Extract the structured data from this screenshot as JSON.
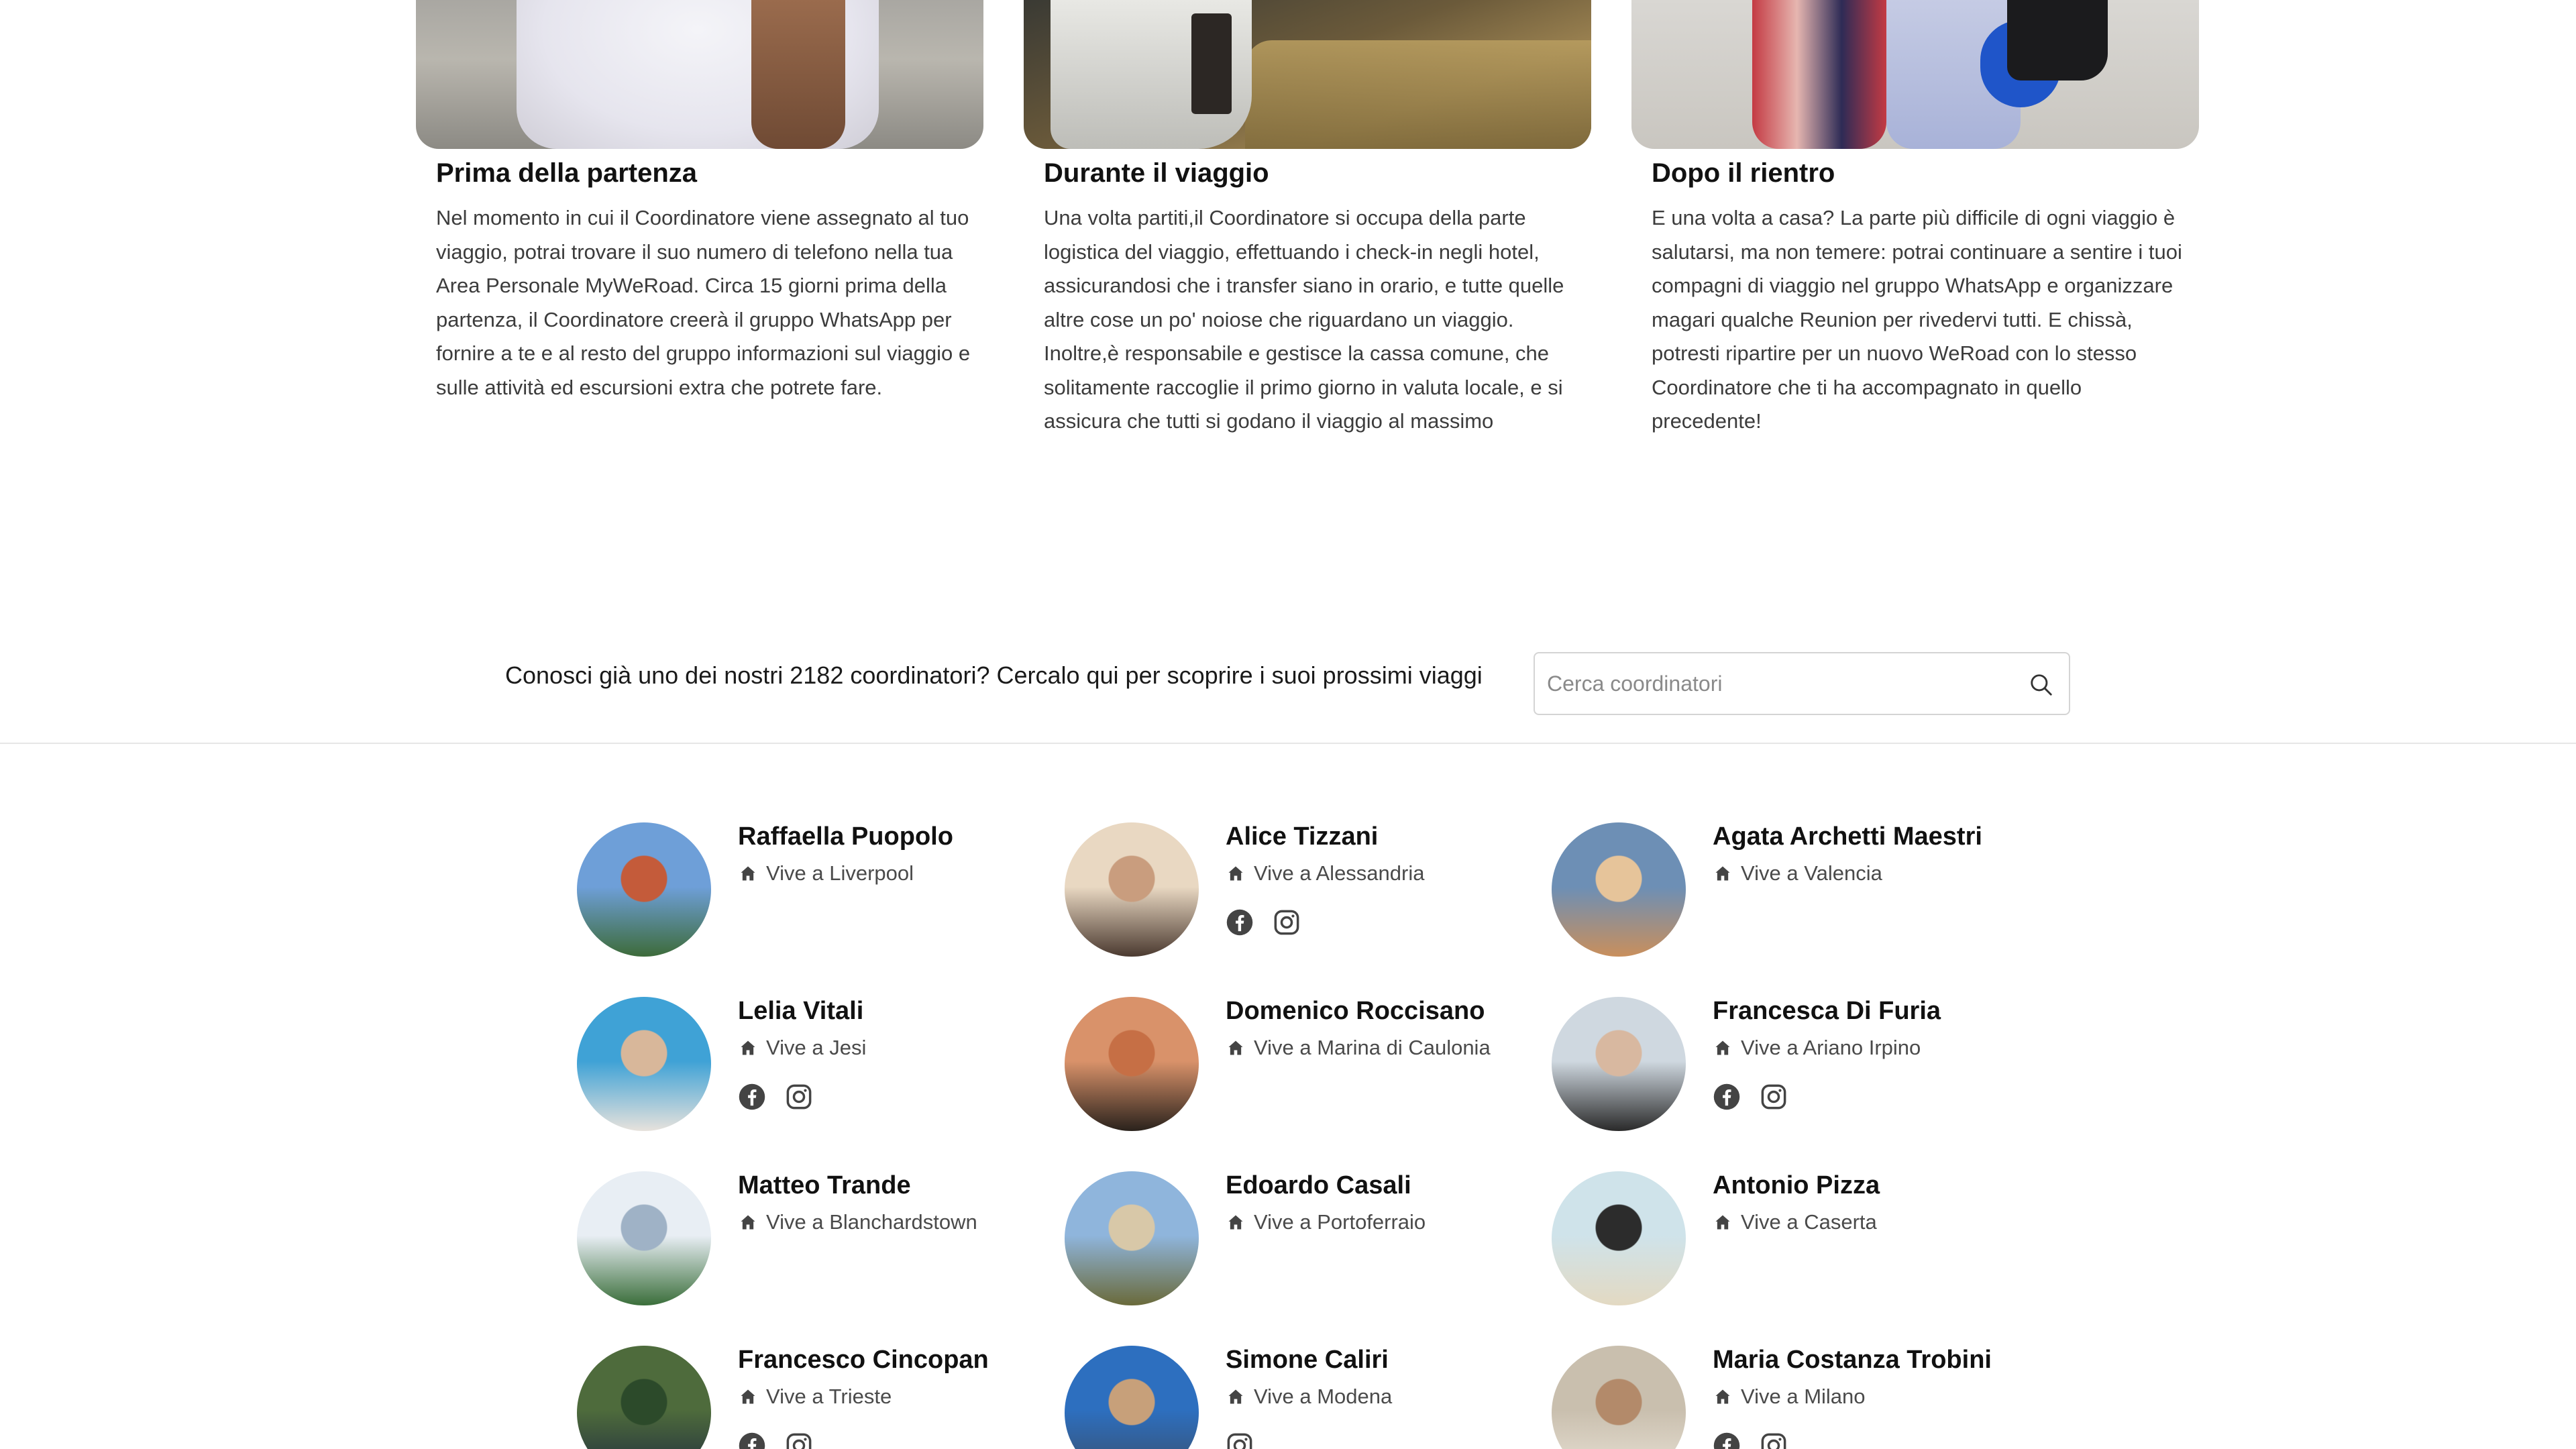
{
  "cards": [
    {
      "photo": "traveler-white-shirt-photo",
      "title": "Prima della partenza",
      "text": "Nel momento in cui il Coordinatore viene assegnato al tuo viaggio, potrai trovare il suo numero di telefono nella tua Area Personale MyWeRoad. Circa 15 giorni prima della partenza, il Coordinatore creerà il gruppo WhatsApp per fornire a te e al resto del gruppo informazioni sul viaggio e sulle attività ed escursioni extra che potrete fare."
    },
    {
      "photo": "travel-bag-puddle-photo",
      "title": "Durante il viaggio",
      "text": "Una volta partiti,il Coordinatore si occupa della parte logistica del viaggio, effettuando i check-in negli hotel, assicurandosi che i transfer siano in orario, e tutte quelle altre cose un po' noiose che riguardano un viaggio. Inoltre,è responsabile e gestisce la cassa comune, che solitamente raccoglie il primo giorno in valuta locale, e si assicura che tutti si godano il viaggio al massimo"
    },
    {
      "photo": "friends-group-photo",
      "title": "Dopo il rientro",
      "text": "E una volta a casa? La parte più difficile di ogni viaggio è salutarsi, ma non temere: potrai continuare a sentire i tuoi compagni di viaggio nel gruppo WhatsApp e organizzare magari qualche Reunion per rivedervi tutti. E chissà, potresti ripartire per un nuovo WeRoad con lo stesso Coordinatore che ti ha accompagnato in quello precedente!"
    }
  ],
  "search": {
    "label": "Conosci già uno dei nostri 2182 coordinatori? Cercalo qui per scoprire i suoi prossimi viaggi",
    "placeholder": "Cerca coordinatori",
    "icon": "search-icon"
  },
  "coordinators": [
    {
      "name": "Raffaella Puopolo",
      "city": "Vive a Liverpool",
      "socials": [],
      "avatar": [
        "#6e9fd8",
        "#c45b3a",
        "#3d6b3a"
      ]
    },
    {
      "name": "Alice Tizzani",
      "city": "Vive a Alessandria",
      "socials": [
        "facebook",
        "instagram"
      ],
      "avatar": [
        "#e9d8c2",
        "#c99d7e",
        "#4b3a30"
      ]
    },
    {
      "name": "Agata Archetti Maestri",
      "city": "Vive a Valencia",
      "socials": [],
      "avatar": [
        "#6d8fb5",
        "#e6c49a",
        "#c98f5c"
      ]
    },
    {
      "name": "Lelia Vitali",
      "city": "Vive a Jesi",
      "socials": [
        "facebook",
        "instagram"
      ],
      "avatar": [
        "#3fa2d6",
        "#d8b79a",
        "#e7e2dc"
      ]
    },
    {
      "name": "Domenico Roccisano",
      "city": "Vive a Marina di Caulonia",
      "socials": [],
      "avatar": [
        "#d9926a",
        "#c66f45",
        "#2a221c"
      ]
    },
    {
      "name": "Francesca Di Furia",
      "city": "Vive a Ariano Irpino",
      "socials": [
        "facebook",
        "instagram"
      ],
      "avatar": [
        "#cfd8e0",
        "#d8b8a0",
        "#2a2a2a"
      ]
    },
    {
      "name": "Matteo Trande",
      "city": "Vive a Blanchardstown",
      "socials": [],
      "avatar": [
        "#e8eef4",
        "#9fb2c6",
        "#3a6e3a"
      ]
    },
    {
      "name": "Edoardo Casali",
      "city": "Vive a Portoferraio",
      "socials": [],
      "avatar": [
        "#8fb5dc",
        "#d8c8a8",
        "#6a6a3a"
      ]
    },
    {
      "name": "Antonio Pizza",
      "city": "Vive a Caserta",
      "socials": [],
      "avatar": [
        "#cfe3ea",
        "#2c2c2c",
        "#e3d9c2"
      ]
    },
    {
      "name": "Francesco Cincopan",
      "city": "Vive a Trieste",
      "socials": [
        "facebook",
        "instagram"
      ],
      "avatar": [
        "#4e6b3c",
        "#2c4a2a",
        "#1f2c3e"
      ]
    },
    {
      "name": "Simone Caliri",
      "city": "Vive a Modena",
      "socials": [
        "instagram"
      ],
      "avatar": [
        "#2d6fbf",
        "#c7a07a",
        "#3a4e6a"
      ]
    },
    {
      "name": "Maria Costanza Trobini",
      "city": "Vive a Milano",
      "socials": [
        "facebook",
        "instagram"
      ],
      "avatar": [
        "#c9bfae",
        "#b38a6a",
        "#e9e2d6"
      ]
    }
  ],
  "icons": {
    "home": "home-icon",
    "facebook": "facebook-icon",
    "instagram": "instagram-icon"
  },
  "colors": {
    "text": "#1a1a1a",
    "muted": "#4a4a4a",
    "icon": "#444444",
    "border": "#d4d4d4"
  }
}
